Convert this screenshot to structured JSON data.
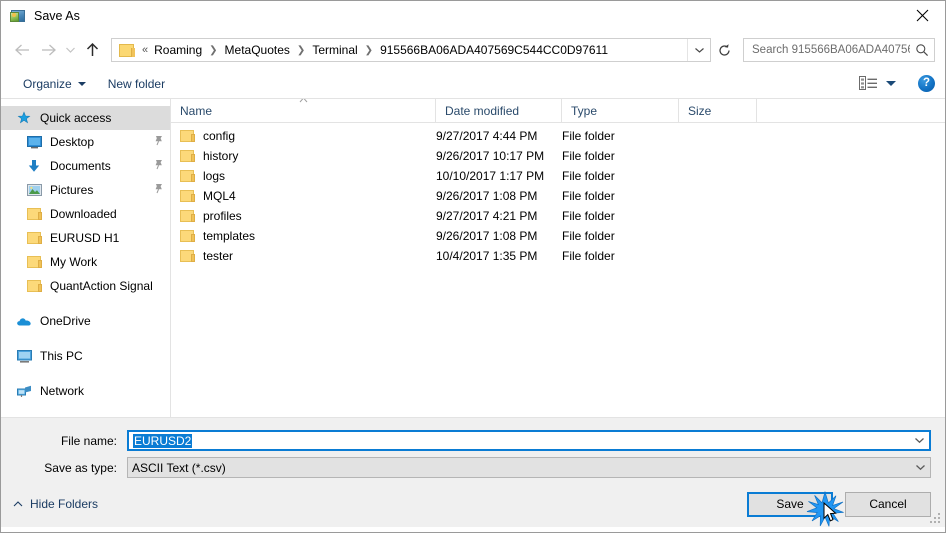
{
  "window": {
    "title": "Save As",
    "app_icon": "metatrader-icon",
    "close_label": "✕"
  },
  "navigation": {
    "back_label": "←",
    "forward_label": "→",
    "recent_label": "⌄",
    "up_label": "↑",
    "breadcrumb": {
      "prefix": "«",
      "items": [
        "Roaming",
        "MetaQuotes",
        "Terminal",
        "915566BA06ADA407569C544CC0D97611"
      ],
      "separator": "❯"
    },
    "address_dropdown": "⌄",
    "refresh_label": "↻"
  },
  "search": {
    "placeholder": "Search 915566BA06ADA40756…",
    "icon": "search-icon"
  },
  "toolbar": {
    "organize_label": "Organize",
    "new_folder_label": "New folder",
    "view_icon": "view-layout-icon",
    "view_caret": "▾",
    "help_label": "?"
  },
  "sidebar": {
    "groups": [
      {
        "items": [
          {
            "label": "Quick access",
            "icon": "star-pin-icon",
            "selected": true,
            "pinned": false,
            "indent": false
          },
          {
            "label": "Desktop",
            "icon": "desktop-icon",
            "selected": false,
            "pinned": true,
            "indent": true
          },
          {
            "label": "Documents",
            "icon": "documents-download-icon",
            "selected": false,
            "pinned": true,
            "indent": true
          },
          {
            "label": "Pictures",
            "icon": "pictures-icon",
            "selected": false,
            "pinned": true,
            "indent": true
          },
          {
            "label": "Downloaded",
            "icon": "folder-icon",
            "selected": false,
            "pinned": false,
            "indent": true
          },
          {
            "label": "EURUSD H1",
            "icon": "folder-icon",
            "selected": false,
            "pinned": false,
            "indent": true
          },
          {
            "label": "My Work",
            "icon": "folder-icon",
            "selected": false,
            "pinned": false,
            "indent": true
          },
          {
            "label": "QuantAction Signal",
            "icon": "folder-icon",
            "selected": false,
            "pinned": false,
            "indent": true
          }
        ]
      },
      {
        "items": [
          {
            "label": "OneDrive",
            "icon": "onedrive-cloud-icon",
            "selected": false,
            "pinned": false,
            "indent": false
          }
        ]
      },
      {
        "items": [
          {
            "label": "This PC",
            "icon": "this-pc-icon",
            "selected": false,
            "pinned": false,
            "indent": false
          }
        ]
      },
      {
        "items": [
          {
            "label": "Network",
            "icon": "network-icon",
            "selected": false,
            "pinned": false,
            "indent": false
          }
        ]
      }
    ]
  },
  "filelist": {
    "columns": [
      "Name",
      "Date modified",
      "Type",
      "Size"
    ],
    "sort_indicator": "▲",
    "rows": [
      {
        "name": "config",
        "date": "9/27/2017 4:44 PM",
        "type": "File folder",
        "size": ""
      },
      {
        "name": "history",
        "date": "9/26/2017 10:17 PM",
        "type": "File folder",
        "size": ""
      },
      {
        "name": "logs",
        "date": "10/10/2017 1:17 PM",
        "type": "File folder",
        "size": ""
      },
      {
        "name": "MQL4",
        "date": "9/26/2017 1:08 PM",
        "type": "File folder",
        "size": ""
      },
      {
        "name": "profiles",
        "date": "9/27/2017 4:21 PM",
        "type": "File folder",
        "size": ""
      },
      {
        "name": "templates",
        "date": "9/26/2017 1:08 PM",
        "type": "File folder",
        "size": ""
      },
      {
        "name": "tester",
        "date": "10/4/2017 1:35 PM",
        "type": "File folder",
        "size": ""
      }
    ]
  },
  "form": {
    "filename_label": "File name:",
    "filename_value": "EURUSD2",
    "filetype_label": "Save as type:",
    "filetype_value": "ASCII Text (*.csv)",
    "dropdown_caret": "⌄"
  },
  "footer": {
    "hide_folders_label": "Hide Folders",
    "hide_folders_caret": "⌃",
    "save_label": "Save",
    "cancel_label": "Cancel",
    "click_indicator": "click-burst",
    "cursor": "mouse-pointer"
  },
  "colors": {
    "accent": "#0a7cd4",
    "selection": "#0a7cd4",
    "folder": "#fcd97a",
    "link_text": "#1b3c63",
    "column_header": "#2a4a6b",
    "sidebar_selected": "#dcdcdc",
    "form_background": "#f0f0f0"
  }
}
